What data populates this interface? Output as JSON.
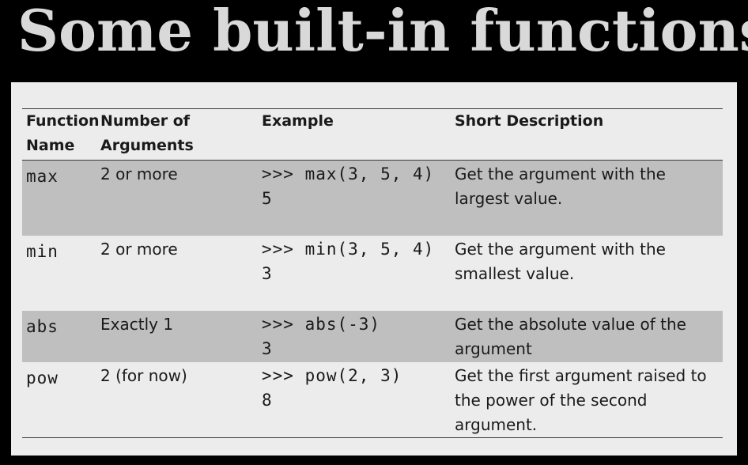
{
  "title": "Some built-in functions",
  "table": {
    "headers": {
      "name": "Function Name",
      "args": "Number of Arguments",
      "example": "Example",
      "description": "Short Description"
    },
    "rows": [
      {
        "name": "max",
        "args": "2 or more",
        "example_call": ">>> max(3, 5, 4)",
        "example_result": "5",
        "description": "Get the argument with the largest value."
      },
      {
        "name": "min",
        "args": "2 or more",
        "example_call": ">>> min(3, 5, 4)",
        "example_result": "3",
        "description": "Get the argument with the smallest value."
      },
      {
        "name": "abs",
        "args": "Exactly 1",
        "example_call": ">>> abs(-3)",
        "example_result": "3",
        "description": "Get the absolute value of the argument"
      },
      {
        "name": "pow",
        "args": "2 (for now)",
        "example_call": ">>> pow(2, 3)",
        "example_result": "8",
        "description": "Get the first argument raised to the power of the second argument."
      }
    ]
  }
}
